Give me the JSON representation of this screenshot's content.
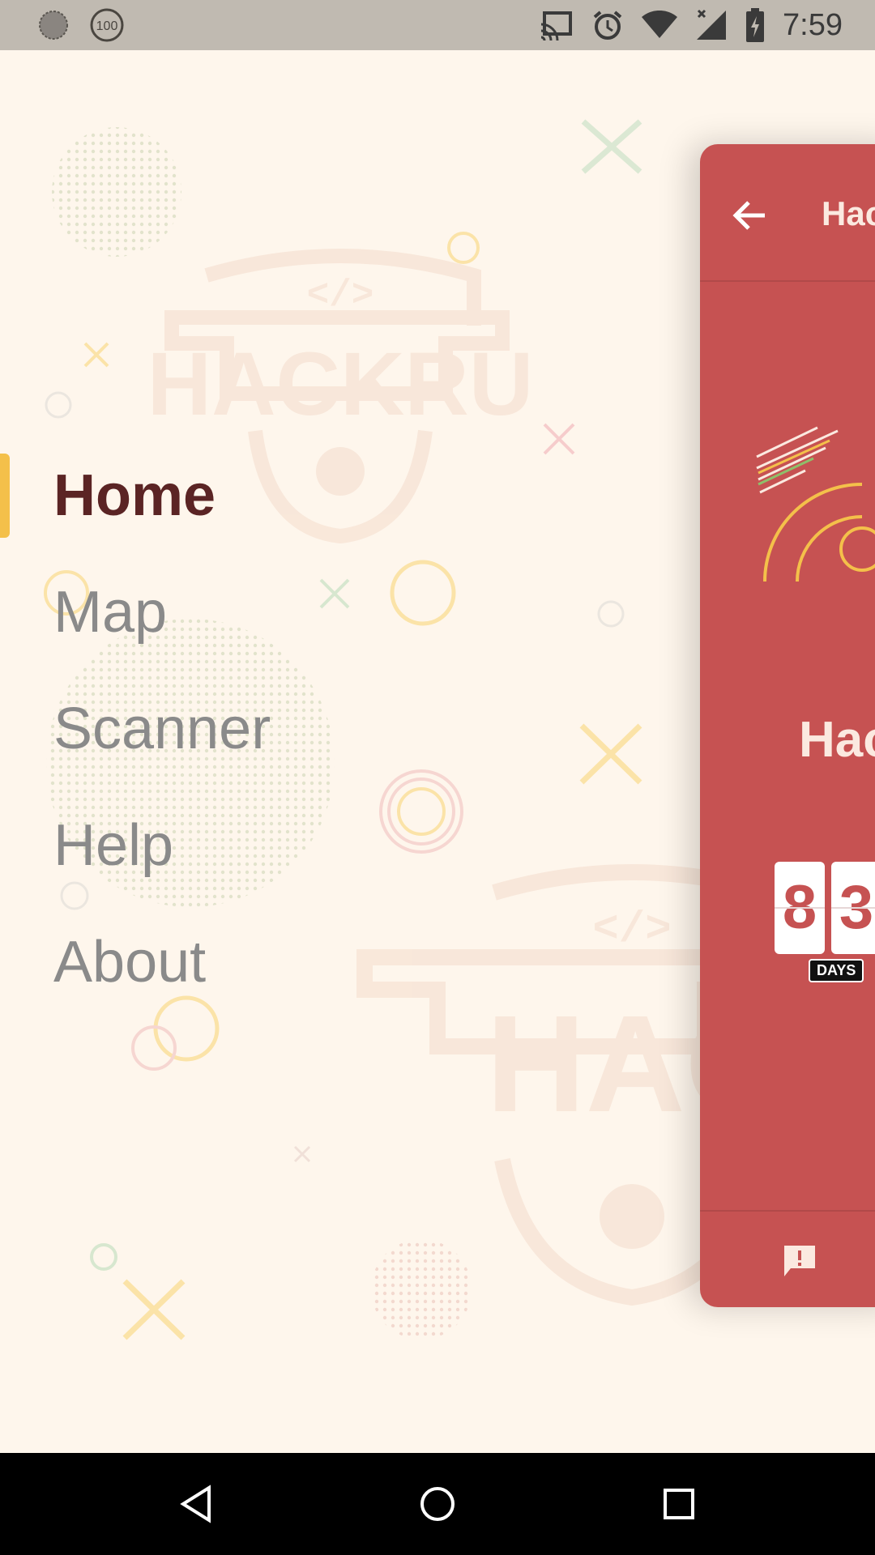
{
  "status_bar": {
    "time": "7:59",
    "battery_badge": "100"
  },
  "menu": {
    "items": [
      {
        "label": "Home",
        "active": true
      },
      {
        "label": "Map",
        "active": false
      },
      {
        "label": "Scanner",
        "active": false
      },
      {
        "label": "Help",
        "active": false
      },
      {
        "label": "About",
        "active": false
      }
    ]
  },
  "card": {
    "title": "Hac",
    "heading": "Hac",
    "countdown_digits": [
      "8",
      "3"
    ],
    "countdown_unit": "DAYS"
  },
  "background": {
    "logo_text": "HACKRU"
  },
  "colors": {
    "accent": "#f4c04a",
    "card": "#c65252",
    "active_text": "#5b2424"
  }
}
